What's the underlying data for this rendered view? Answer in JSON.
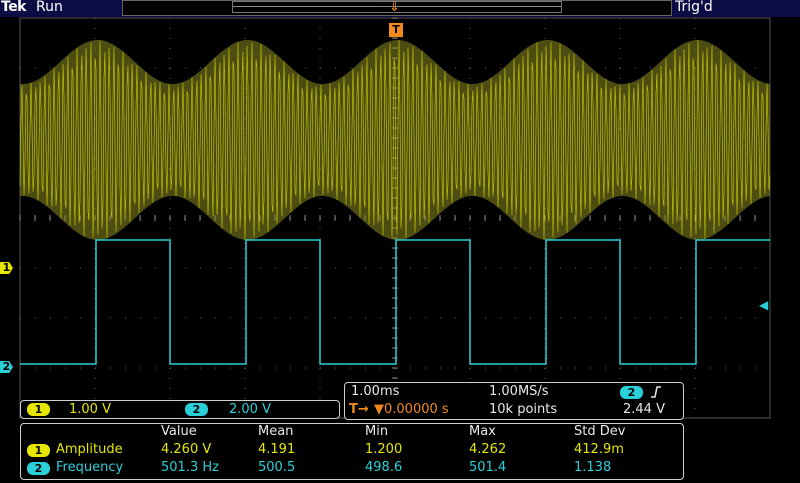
{
  "header": {
    "brand": "Tek",
    "run_state": "Run",
    "trigger_status": "Trig'd"
  },
  "trigger_marker": "T",
  "channel_markers": [
    "1",
    "2"
  ],
  "channels": [
    {
      "id": "1",
      "scale": "1.00 V",
      "color": "#e6e600"
    },
    {
      "id": "2",
      "scale": "2.00 V",
      "color": "#2ad0d8"
    }
  ],
  "timebase": {
    "horiz_scale": "1.00ms",
    "sample_rate": "1.00MS/s",
    "trigger_source": "2",
    "trigger_slope_icon": "rising-edge-icon",
    "position": "▼0.00000 s",
    "record_length": "10k points",
    "trigger_level": "2.44 V"
  },
  "measurements": {
    "headers": [
      "Value",
      "Mean",
      "Min",
      "Max",
      "Std Dev"
    ],
    "rows": [
      {
        "channel": "1",
        "name": "Amplitude",
        "value": "4.260 V",
        "mean": "4.191",
        "min": "1.200",
        "max": "4.262",
        "std": "412.9m"
      },
      {
        "channel": "2",
        "name": "Frequency",
        "value": "501.3 Hz",
        "mean": "500.5",
        "min": "498.6",
        "max": "501.4",
        "std": "1.138"
      }
    ]
  },
  "colors": {
    "ch1": "#e6e600",
    "ch2": "#2ad0d8",
    "trigger": "#f08a1c",
    "header_bg": "#0c0c44"
  }
}
